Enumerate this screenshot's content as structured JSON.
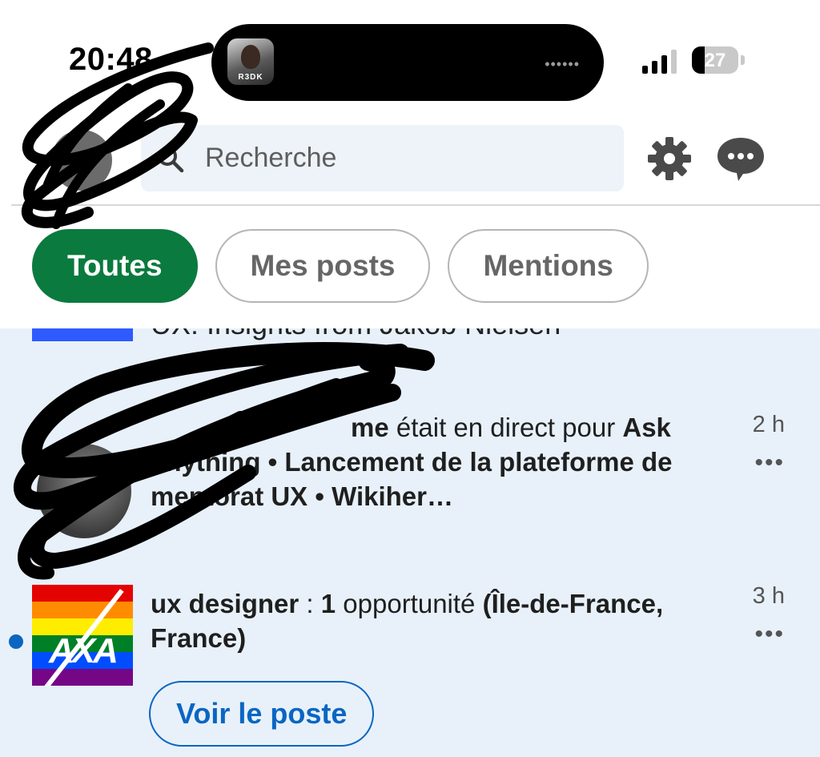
{
  "status_bar": {
    "time": "20:48",
    "battery_level": "27",
    "island_avatar_tag": "R3DK"
  },
  "header": {
    "search_placeholder": "Recherche"
  },
  "filters": [
    {
      "label": "Toutes",
      "active": true
    },
    {
      "label": "Mes posts",
      "active": false
    },
    {
      "label": "Mentions",
      "active": false
    }
  ],
  "feed": {
    "partial_item_text": "UX: Insights from Jakob Nielsen",
    "items": [
      {
        "text_bold_1": "me",
        "text_plain_1": " était en direct pour ",
        "text_bold_2": "Ask",
        "text_bold_3": "anything • Lancement de la plateforme de mentorat UX • Wikiher…",
        "time": "2 h",
        "more": "•••"
      },
      {
        "text_bold_1": "ux designer",
        "text_plain_1": " : ",
        "text_bold_2": "1",
        "text_plain_2": " opportunité ",
        "text_bold_3": "(Île-de-France, France)",
        "time": "3 h",
        "more": "•••",
        "logo_mark": "AXA",
        "cta_label": "Voir le poste"
      }
    ]
  },
  "colors": {
    "accent_green": "#0a7a3e",
    "link_blue": "#0a66c2",
    "feed_background": "#e8f1fa"
  }
}
